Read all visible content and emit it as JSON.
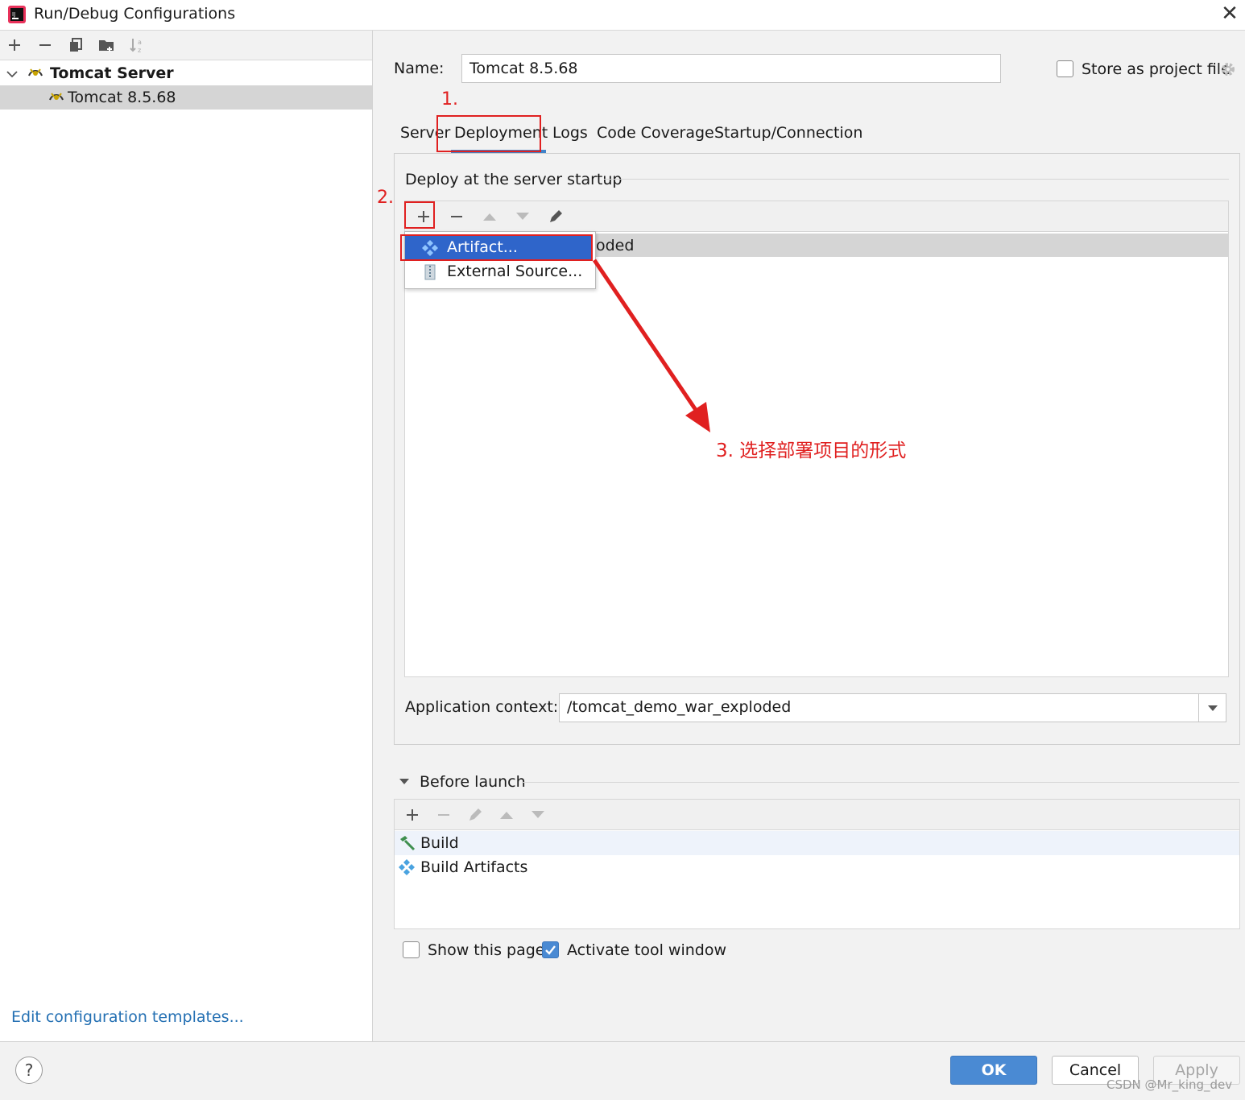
{
  "window": {
    "title": "Run/Debug Configurations",
    "icon": "intellij-app-icon"
  },
  "left_panel": {
    "toolbar": [
      "add-icon",
      "remove-icon",
      "copy-icon",
      "folder-icon",
      "sort-icon"
    ],
    "tree": {
      "group_label": "Tomcat Server",
      "child_label": "Tomcat 8.5.68"
    },
    "edit_templates_link": "Edit configuration templates..."
  },
  "config": {
    "name_label": "Name:",
    "name_value": "Tomcat 8.5.68",
    "store_label": "Store as project file",
    "store_checked": false
  },
  "annotations": {
    "step1": "1.",
    "step2": "2.",
    "step3": "3. 选择部署项目的形式",
    "color": "#e02020"
  },
  "tabs": {
    "items": [
      "Server",
      "Deployment",
      "Logs",
      "Code Coverage",
      "Startup/Connection"
    ],
    "active": "Deployment"
  },
  "deployment": {
    "section_title": "Deploy at the server startup",
    "list_item_visible_text": "oded",
    "popup": {
      "artifact": "Artifact...",
      "external_source": "External Source..."
    },
    "context_label": "Application context:",
    "context_value": "/tomcat_demo_war_exploded"
  },
  "before_launch": {
    "title": "Before launch",
    "items": [
      "Build",
      "Build Artifacts"
    ]
  },
  "options": {
    "show_page_label": "Show this page",
    "show_page_checked": false,
    "activate_label": "Activate tool window",
    "activate_checked": true
  },
  "buttons": {
    "help": "?",
    "ok": "OK",
    "cancel": "Cancel",
    "apply": "Apply"
  },
  "watermark": "CSDN @Mr_king_dev",
  "colors": {
    "accent": "#4a8ad3",
    "selection": "#2f65ca",
    "link": "#2470b3"
  }
}
